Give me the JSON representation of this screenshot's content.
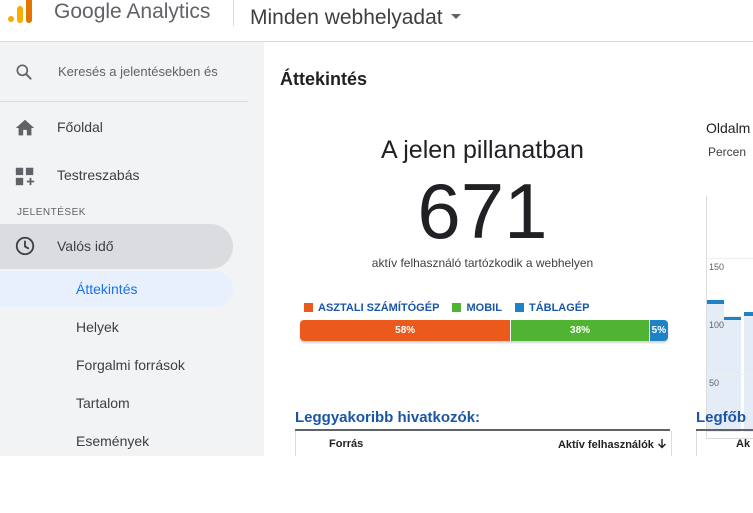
{
  "header": {
    "brand": "Google Analytics",
    "property": "Minden webhelyadat"
  },
  "sidebar": {
    "search_text": "Keresés a jelentésekben és",
    "items": [
      {
        "label": "Főoldal",
        "icon": "home-icon"
      },
      {
        "label": "Testreszabás",
        "icon": "customization-icon"
      }
    ],
    "section_label": "JELENTÉSEK",
    "realtime_label": "Valós idő",
    "realtime_icon": "clock-icon",
    "sub_items": [
      {
        "label": "Áttekintés",
        "active": true
      },
      {
        "label": "Helyek"
      },
      {
        "label": "Forgalmi források"
      },
      {
        "label": "Tartalom"
      },
      {
        "label": "Események"
      }
    ]
  },
  "main": {
    "title": "Áttekintés",
    "realtime_heading": "A jelen pillanatban",
    "active_count": "671",
    "active_sub": "aktív felhasználó tartózkodik a webhelyen",
    "device_legend": [
      {
        "label": "ASZTALI SZÁMÍTÓGÉP",
        "color": "#ea5a1c"
      },
      {
        "label": "MOBIL",
        "color": "#50b432"
      },
      {
        "label": "TÁBLAGÉP",
        "color": "#1f82c5"
      }
    ],
    "device_split": [
      {
        "label": "58%",
        "value": 58,
        "color": "#ea5a1c"
      },
      {
        "label": "38%",
        "value": 38,
        "color": "#50b432"
      },
      {
        "label": "5%",
        "value": 5,
        "color": "#1f82c5"
      }
    ],
    "pageviews_chart": {
      "title": "Oldalm",
      "subtitle": "Percen",
      "ticks": [
        "150",
        "100",
        "50"
      ]
    },
    "referrals": {
      "title": "Leggyakoribb hivatkozók:",
      "col_source": "Forrás",
      "col_active": "Aktív felhasználók"
    },
    "second_table": {
      "title": "Legfőb",
      "col": "Ak"
    }
  },
  "chart_data": {
    "type": "bar",
    "title": "Oldalm",
    "subtitle": "Percen",
    "ylim": [
      0,
      200
    ],
    "yticks": [
      150,
      100,
      50
    ],
    "values": [
      112,
      98,
      102
    ]
  }
}
